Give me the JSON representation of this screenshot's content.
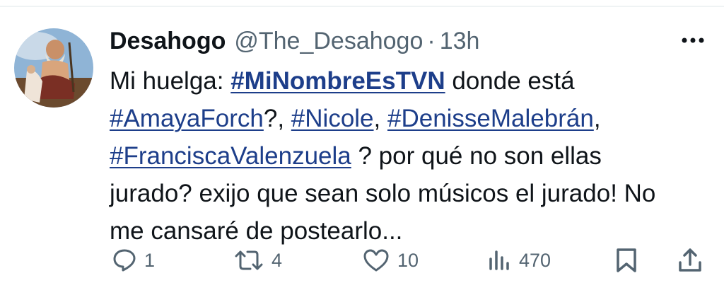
{
  "tweet": {
    "author_name": "Desahogo",
    "handle": "@The_Desahogo",
    "separator": "·",
    "time": "13h",
    "avatar": "avatar",
    "text": {
      "l1_pre": "Mi huelga: ",
      "tag_tvn": "#MiNombreEsTVN",
      "l1_post": " donde está",
      "tag_amaya": "#AmayaForch",
      "l2_sep1": "?, ",
      "tag_nicole": "#Nicole",
      "l2_sep2": ", ",
      "tag_denisse": "#DenisseMalebrán",
      "l2_sep3": ",",
      "tag_francisca": "#FranciscaValenzuela",
      "l3_post": " ? por qué no son ellas",
      "line4": "jurado? exijo que sean solo músicos el jurado! No",
      "line5": "me cansaré de  postearlo..."
    }
  },
  "actions": {
    "reply_count": "1",
    "retweet_count": "4",
    "like_count": "10",
    "views_count": "470"
  },
  "icons": {
    "more": "more-horizontal-icon",
    "reply": "reply-icon",
    "retweet": "retweet-icon",
    "like": "heart-icon",
    "views": "views-chart-icon",
    "bookmark": "bookmark-icon",
    "share": "share-icon"
  },
  "colors": {
    "text": "#0f1419",
    "secondary": "#536471",
    "hashtag": "#1d3e8a",
    "background": "#ffffff"
  }
}
